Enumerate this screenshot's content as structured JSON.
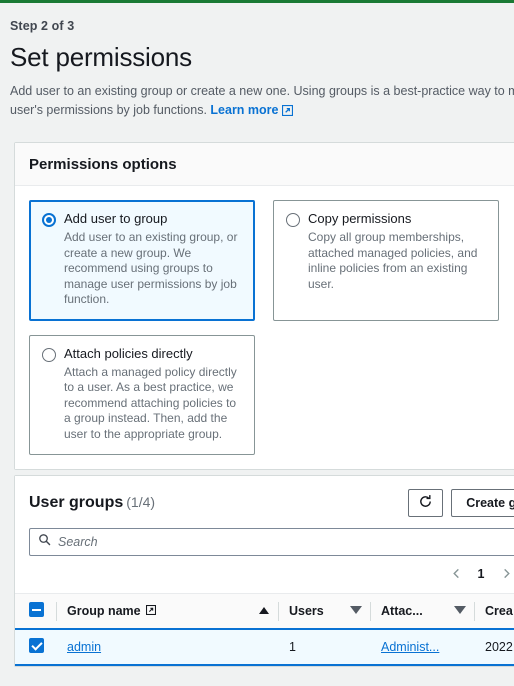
{
  "theme": {
    "accent_green": "#1a7a35",
    "link_blue": "#0972d3",
    "page_bg": "#f0f2f2",
    "selected_row_bg": "#f1faff"
  },
  "header": {
    "step_label": "Step 2 of 3",
    "title": "Set permissions",
    "description": "Add user to an existing group or create a new one. Using groups is a best-practice way to manage user's permissions by job functions.",
    "learn_more_label": "Learn more",
    "learn_more_icon": "external-link-icon"
  },
  "permissions_card": {
    "header_title": "Permissions options",
    "options": [
      {
        "label": "Add user to group",
        "description": "Add user to an existing group, or create a new group. We recommend using groups to manage user permissions by job function.",
        "selected": true
      },
      {
        "label": "Copy permissions",
        "description": "Copy all group memberships, attached managed policies, and inline policies from an existing user.",
        "selected": false
      },
      {
        "label": "Attach policies directly",
        "description": "Attach a managed policy directly to a user. As a best practice, we recommend attaching policies to a group instead. Then, add the user to the appropriate group.",
        "selected": false
      }
    ]
  },
  "groups_card": {
    "title": "User groups",
    "count": "(1/4)",
    "refresh_icon": "refresh-icon",
    "create_group_label": "Create group",
    "search": {
      "placeholder": "Search",
      "value": "",
      "icon": "search-icon"
    },
    "pagination": {
      "prev_icon": "chevron-left-icon",
      "page": "1",
      "next_icon": "chevron-right-icon",
      "settings_icon": "gear-icon"
    },
    "table": {
      "select_all_state": "indeterminate",
      "columns": [
        {
          "label": "Group name",
          "has_external_icon": true,
          "sort": "asc"
        },
        {
          "label": "Users",
          "has_external_icon": false,
          "sort": "none"
        },
        {
          "label": "Attac...",
          "has_external_icon": false,
          "sort": "none"
        },
        {
          "label": "Crea",
          "has_external_icon": false,
          "sort": "none"
        }
      ],
      "rows": [
        {
          "selected": true,
          "group_name": "admin",
          "users": "1",
          "attached_policies": "Administ...",
          "created": "2022"
        }
      ]
    }
  }
}
